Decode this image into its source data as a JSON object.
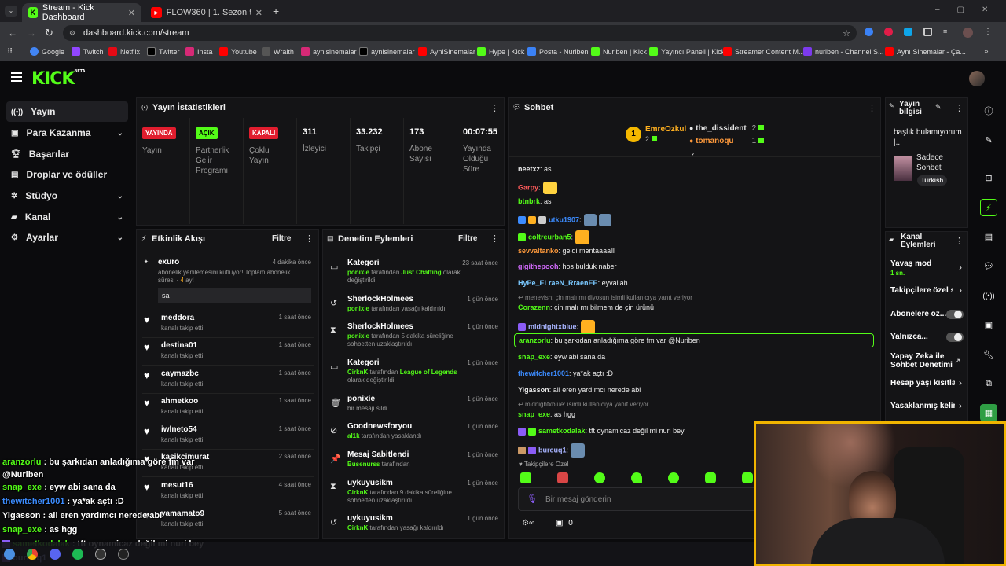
{
  "browser": {
    "tabs": [
      {
        "label": "Stream - Kick Dashboard"
      },
      {
        "label": "FLOW360 | 1. Sezon 9. Bölüm |"
      }
    ],
    "url": "dashboard.kick.com/stream",
    "bookmarks": [
      "Google",
      "Twitch",
      "Netflix",
      "Twitter",
      "Insta",
      "Youtube",
      "Wraith",
      "aynisinemalar",
      "aynisinemalar",
      "AyniSinemalar",
      "Hype | Kick",
      "Posta - Nuriben",
      "Nuriben | Kick",
      "Yayıncı Paneli | Kick",
      "Streamer Content M...",
      "nuriben - Channel S...",
      "Aynı Sinemalar - Ça..."
    ]
  },
  "kick": {
    "logo": "KICK",
    "beta": "BETA",
    "sidebar": [
      {
        "label": "Yayın"
      },
      {
        "label": "Para Kazanma"
      },
      {
        "label": "Başarılar"
      },
      {
        "label": "Droplar ve ödüller"
      },
      {
        "label": "Stüdyo"
      },
      {
        "label": "Kanal"
      },
      {
        "label": "Ayarlar"
      }
    ],
    "stats": {
      "title": "Yayın İstatistikleri",
      "items": [
        {
          "badge": "YAYINDA",
          "label": "Yayın"
        },
        {
          "badge": "AÇIK",
          "label": "Partnerlik Gelir Programı"
        },
        {
          "badge": "KAPALI",
          "label": "Çoklu Yayın"
        },
        {
          "value": "311",
          "label": "İzleyici"
        },
        {
          "value": "33.232",
          "label": "Takipçi"
        },
        {
          "value": "173",
          "label": "Abone Sayısı"
        },
        {
          "value": "00:07:55",
          "label": "Yayında Olduğu Süre"
        }
      ]
    },
    "activity": {
      "title": "Etkinlik Akışı",
      "filter": "Filtre",
      "sub": {
        "name": "exuro",
        "time": "4 dakika önce",
        "text1": "abonelik yenilemesini kutluyor! Toplam abonelik",
        "text2": "süresi - ",
        "months": "4",
        "text3": " ay!",
        "msg": "sa"
      },
      "items": [
        {
          "name": "meddora",
          "sub": "kanalı takip etti",
          "time": "1 saat önce"
        },
        {
          "name": "destina01",
          "sub": "kanalı takip etti",
          "time": "1 saat önce"
        },
        {
          "name": "caymazbc",
          "sub": "kanalı takip etti",
          "time": "1 saat önce"
        },
        {
          "name": "ahmetkoo",
          "sub": "kanalı takip etti",
          "time": "1 saat önce"
        },
        {
          "name": "iwlneto54",
          "sub": "kanalı takip etti",
          "time": "1 saat önce"
        },
        {
          "name": "kasikcimurat",
          "sub": "kanalı takip etti",
          "time": "2 saat önce"
        },
        {
          "name": "mesut16",
          "sub": "kanalı takip etti",
          "time": "4 saat önce"
        },
        {
          "name": "yamamato9",
          "sub": "kanalı takip etti",
          "time": "5 saat önce"
        }
      ]
    },
    "mod": {
      "title": "Denetim Eylemleri",
      "filter": "Filtre",
      "items": [
        {
          "title": "Kategori",
          "time": "23 saat önce",
          "actor": "ponixie",
          "mid": " tarafından ",
          "hl": "Just Chatting",
          "rest": " olarak değiştirildi",
          "icon": "▭"
        },
        {
          "title": "SherlockHolmees",
          "time": "1 gün önce",
          "actor": "ponixie",
          "mid": " tarafından yasağı kaldırıldı",
          "hl": "",
          "rest": "",
          "icon": "↺"
        },
        {
          "title": "SherlockHolmees",
          "time": "1 gün önce",
          "actor": "ponixie",
          "mid": " tarafından 5 dakika süreliğine sohbetten uzaklaştırıldı",
          "hl": "",
          "rest": "",
          "icon": "⧗"
        },
        {
          "title": "Kategori",
          "time": "1 gün önce",
          "actor": "CirknK",
          "mid": " tarafından ",
          "hl": "League of Legends",
          "rest": " olarak değiştirildi",
          "icon": "▭"
        },
        {
          "title": "ponixie",
          "time": "1 gün önce",
          "actor": "",
          "mid": "bir mesajı sildi",
          "hl": "",
          "rest": "",
          "icon": "🗑"
        },
        {
          "title": "Goodnewsforyou",
          "time": "1 gün önce",
          "actor": "al1k",
          "mid": " tarafından yasaklandı",
          "hl": "",
          "rest": "",
          "icon": "⊘"
        },
        {
          "title": "Mesaj Sabitlendi",
          "time": "1 gün önce",
          "actor": "Busenurss",
          "mid": " tarafından",
          "hl": "",
          "rest": "",
          "icon": "📌"
        },
        {
          "title": "uykuyusikm",
          "time": "1 gün önce",
          "actor": "CirknK",
          "mid": " tarafından 9 dakika süreliğine sohbetten uzaklaştırıldı",
          "hl": "",
          "rest": "",
          "icon": "⧗"
        },
        {
          "title": "uykuyusikm",
          "time": "1 gün önce",
          "actor": "CirknK",
          "mid": " tarafından yasağı kaldırıldı",
          "hl": "",
          "rest": "",
          "icon": "↺"
        }
      ]
    },
    "chat": {
      "title": "Sohbet",
      "leaders": [
        {
          "name": "EmreOzkul",
          "count": "2"
        },
        {
          "name": "the_dissident",
          "count": "2"
        },
        {
          "name": "tomanoqu",
          "count": "1"
        }
      ],
      "rank": "1",
      "messages": [
        {
          "user": "neetxz",
          "color": "#e8e8e8",
          "text": ": as"
        },
        {
          "user": "Garpy",
          "color": "#ff5a5a",
          "text": ":"
        },
        {
          "user": "btnbrk",
          "color": "#53fc18",
          "text": ": as"
        },
        {
          "user": "utku1907",
          "color": "#3c8cff",
          "text": ":"
        },
        {
          "user": "coltreurban5",
          "color": "#53fc18",
          "text": ":"
        },
        {
          "user": "sevvaltanko",
          "color": "#ff9a3c",
          "text": ": geldi mentaaaalll"
        },
        {
          "user": "gigithepooh",
          "color": "#d46bff",
          "text": ": hos bulduk naber"
        },
        {
          "user": "HyPe_ELraeN_RraenEE",
          "color": "#7ac8ff",
          "text": ": eyvallah"
        },
        {
          "user": "Corazenn",
          "color": "#53fc18",
          "text": ": çin malı mı bilmem de çin ürünü",
          "reply": "menevish: çin malı mı diyosun isimli kullanıcıya yanıt veriyor"
        },
        {
          "user": "midnightxblue",
          "color": "#a8b4ff",
          "text": ":"
        },
        {
          "user": "aranzorlu",
          "color": "#53fc18",
          "text": ": bu şarkıdan anladığıma göre fm var @Nuriben"
        },
        {
          "user": "snap_exe",
          "color": "#53fc18",
          "text": ": eyw abi sana da"
        },
        {
          "user": "thewitcher1001",
          "color": "#3c8cff",
          "text": ": ya*ak açtı :D"
        },
        {
          "user": "Yigasson",
          "color": "#e8e8e8",
          "text": ": ali eren yardımcı nerede abi"
        },
        {
          "user": "snap_exe",
          "color": "#53fc18",
          "text": ": as hgg",
          "reply": "midnightxblue:  isimli kullanıcıya yanıt veriyor"
        },
        {
          "user": "sametkodalak",
          "color": "#53fc18",
          "text": ": tft oynamicaz değil mi nuri bey"
        },
        {
          "user": "burcuq1",
          "color": "#a8b4ff",
          "text": ":"
        }
      ],
      "followers_only": "Takipçilere Özel",
      "input_placeholder": "Bir mesaj gönderin",
      "points": "0"
    },
    "info": {
      "title1": "Yayın",
      "title2": "bilgisi",
      "stream_title": "başlık bulamıyorum |...",
      "mode1": "Sadece",
      "mode2": "Sohbet",
      "lang": "Turkish"
    },
    "channel_actions": {
      "title1": "Kanal",
      "title2": "Eylemleri",
      "items": [
        {
          "label": "Yavaş mod",
          "sub": "1 sn."
        },
        {
          "label": "Takipçilere özel s"
        },
        {
          "label": "Abonelere öz..."
        },
        {
          "label": "Yalnızca..."
        },
        {
          "label": "Yapay Zeka ile Sohbet Denetimi"
        },
        {
          "label": "Hesap yaşı kısıtla"
        },
        {
          "label": "Yasaklanmış kelin"
        }
      ]
    }
  },
  "overlay": {
    "lines": [
      {
        "user": "aranzorlu",
        "color": "#53fc18",
        "text": " : bu şarkıdan anladığıma göre fm var"
      },
      {
        "user": "",
        "color": "#fff",
        "text": "@Nuriben"
      },
      {
        "user": "snap_exe",
        "color": "#53fc18",
        "text": " : eyw abi sana da"
      },
      {
        "user": "thewitcher1001",
        "color": "#3c8cff",
        "text": " : ya*ak açtı :D"
      },
      {
        "user": "Yigasson",
        "color": "#fff",
        "text": " : ali eren yardımcı nerede abi"
      },
      {
        "user": "snap_exe",
        "color": "#53fc18",
        "text": " : as hgg"
      },
      {
        "user": "sametkodalak",
        "color": "#53fc18",
        "text": " : tft oynamicaz değil mi nuri bey"
      },
      {
        "user": "burcuq1",
        "color": "#a8b4ff",
        "text": ""
      }
    ]
  }
}
